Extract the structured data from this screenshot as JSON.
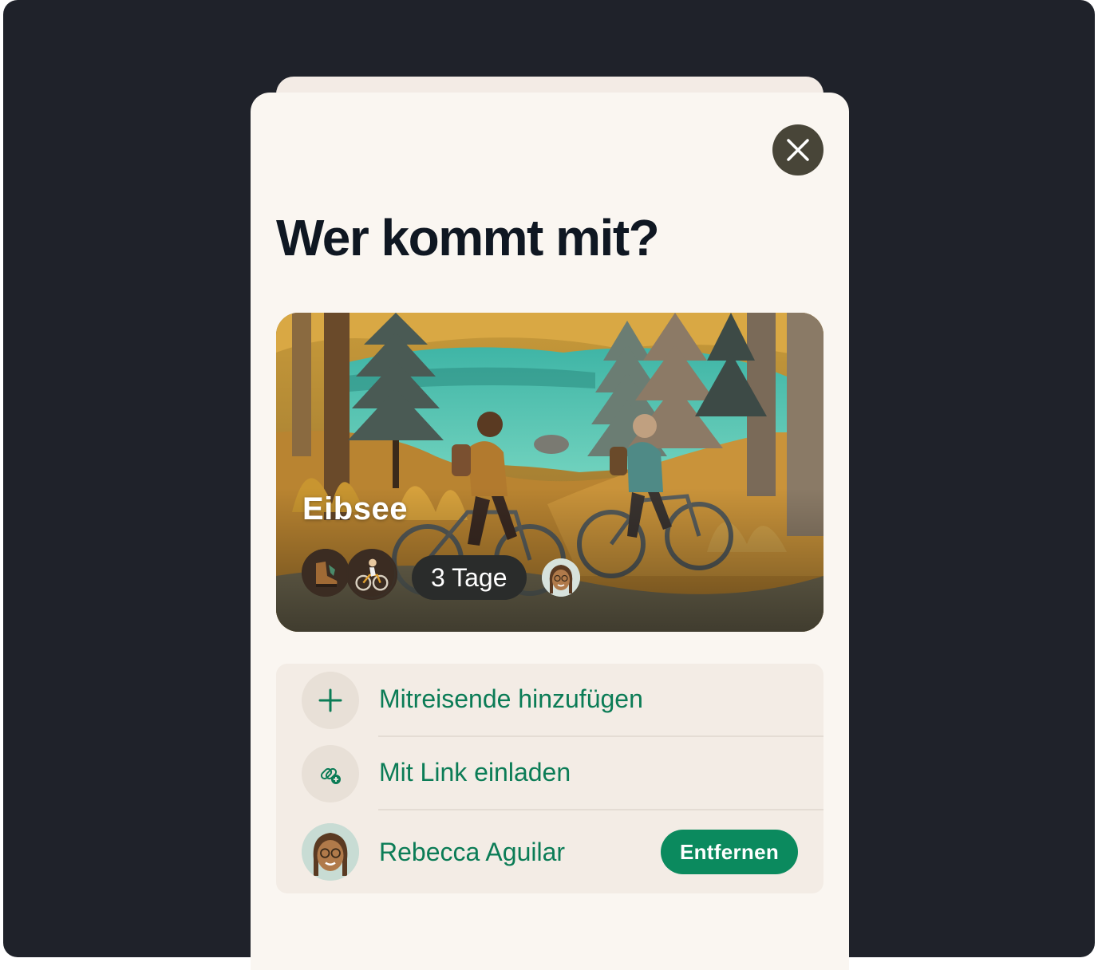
{
  "dialog": {
    "title": "Wer kommt mit?",
    "close_icon": "close-icon"
  },
  "trip_card": {
    "name": "Eibsee",
    "duration": "3 Tage",
    "image": "paper-craft-forest-lake-cyclists",
    "activity_icons": [
      "hiking-boot-icon",
      "cyclist-icon"
    ],
    "traveler_avatar": "memoji-avatar"
  },
  "actions": [
    {
      "label": "Mitreisende hinzufügen",
      "icon": "plus-icon"
    },
    {
      "label": "Mit Link einladen",
      "icon": "link-add-icon"
    }
  ],
  "travelers": [
    {
      "name": "Rebecca Aguilar",
      "action_label": "Entfernen",
      "avatar": "memoji-avatar"
    }
  ],
  "colors": {
    "backdrop": "#1f222a",
    "sheet": "#faf6f1",
    "list_bg": "#f3ece5",
    "accent_green": "#0b8a5e",
    "link_green": "#0b7c56",
    "close_button": "#484538",
    "title": "#0f1722"
  }
}
